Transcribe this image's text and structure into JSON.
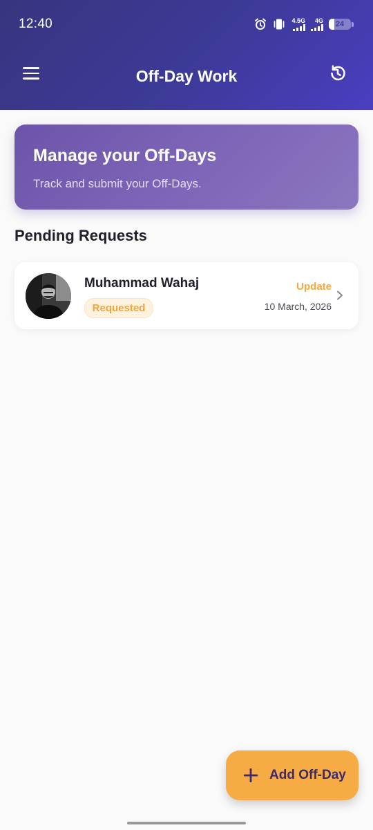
{
  "status_bar": {
    "time": "12:40",
    "network_1": "4.5G",
    "network_2": "4G",
    "battery_level": "24",
    "battery_fraction": 0.24
  },
  "app_bar": {
    "title": "Off-Day Work",
    "menu_icon": "menu-icon",
    "history_icon": "history-icon"
  },
  "banner": {
    "title": "Manage your Off-Days",
    "subtitle": "Track and submit your Off-Days."
  },
  "section": {
    "title": "Pending Requests"
  },
  "requests": [
    {
      "name": "Muhammad Wahaj",
      "status": "Requested",
      "action": "Update",
      "date": "10 March, 2026"
    }
  ],
  "fab": {
    "label": "Add Off-Day",
    "icon": "plus-icon"
  },
  "colors": {
    "header": "#3d3a99",
    "banner": "#7a62b5",
    "accent_orange": "#f6ab44",
    "fab_text": "#3d2a6e",
    "badge_bg": "#fff3e0"
  }
}
